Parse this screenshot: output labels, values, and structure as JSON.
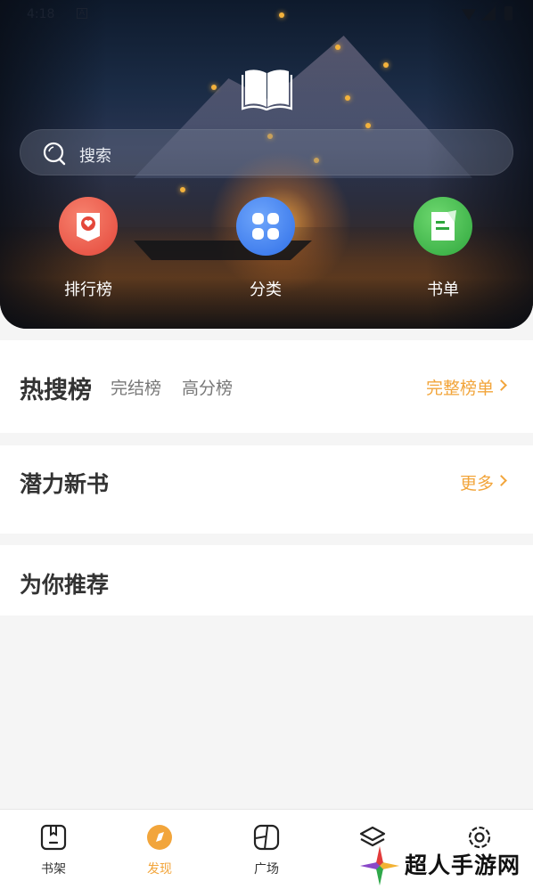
{
  "status_bar": {
    "time": "4:18",
    "a_icon": "A"
  },
  "search": {
    "placeholder": "搜索"
  },
  "quick_actions": [
    {
      "label": "排行榜",
      "icon": "ranking-icon",
      "color": "#e8503e"
    },
    {
      "label": "分类",
      "icon": "category-icon",
      "color": "#3d7ff0"
    },
    {
      "label": "书单",
      "icon": "booklist-icon",
      "color": "#3ab44a"
    }
  ],
  "hot_search": {
    "title": "热搜榜",
    "tabs": [
      "完结榜",
      "高分榜"
    ],
    "more": "完整榜单"
  },
  "potential": {
    "title": "潜力新书",
    "more": "更多"
  },
  "recommend": {
    "title": "为你推荐"
  },
  "bottom_nav": [
    {
      "label": "书架",
      "icon": "bookshelf-icon",
      "active": false
    },
    {
      "label": "发现",
      "icon": "discover-icon",
      "active": true
    },
    {
      "label": "广场",
      "icon": "square-icon",
      "active": false
    },
    {
      "label": "",
      "icon": "layers-icon",
      "active": false
    },
    {
      "label": "",
      "icon": "settings-icon",
      "active": false
    }
  ],
  "watermark": {
    "text": "超人手游网"
  },
  "colors": {
    "accent": "#f2a53b",
    "text_dark": "#333333"
  }
}
